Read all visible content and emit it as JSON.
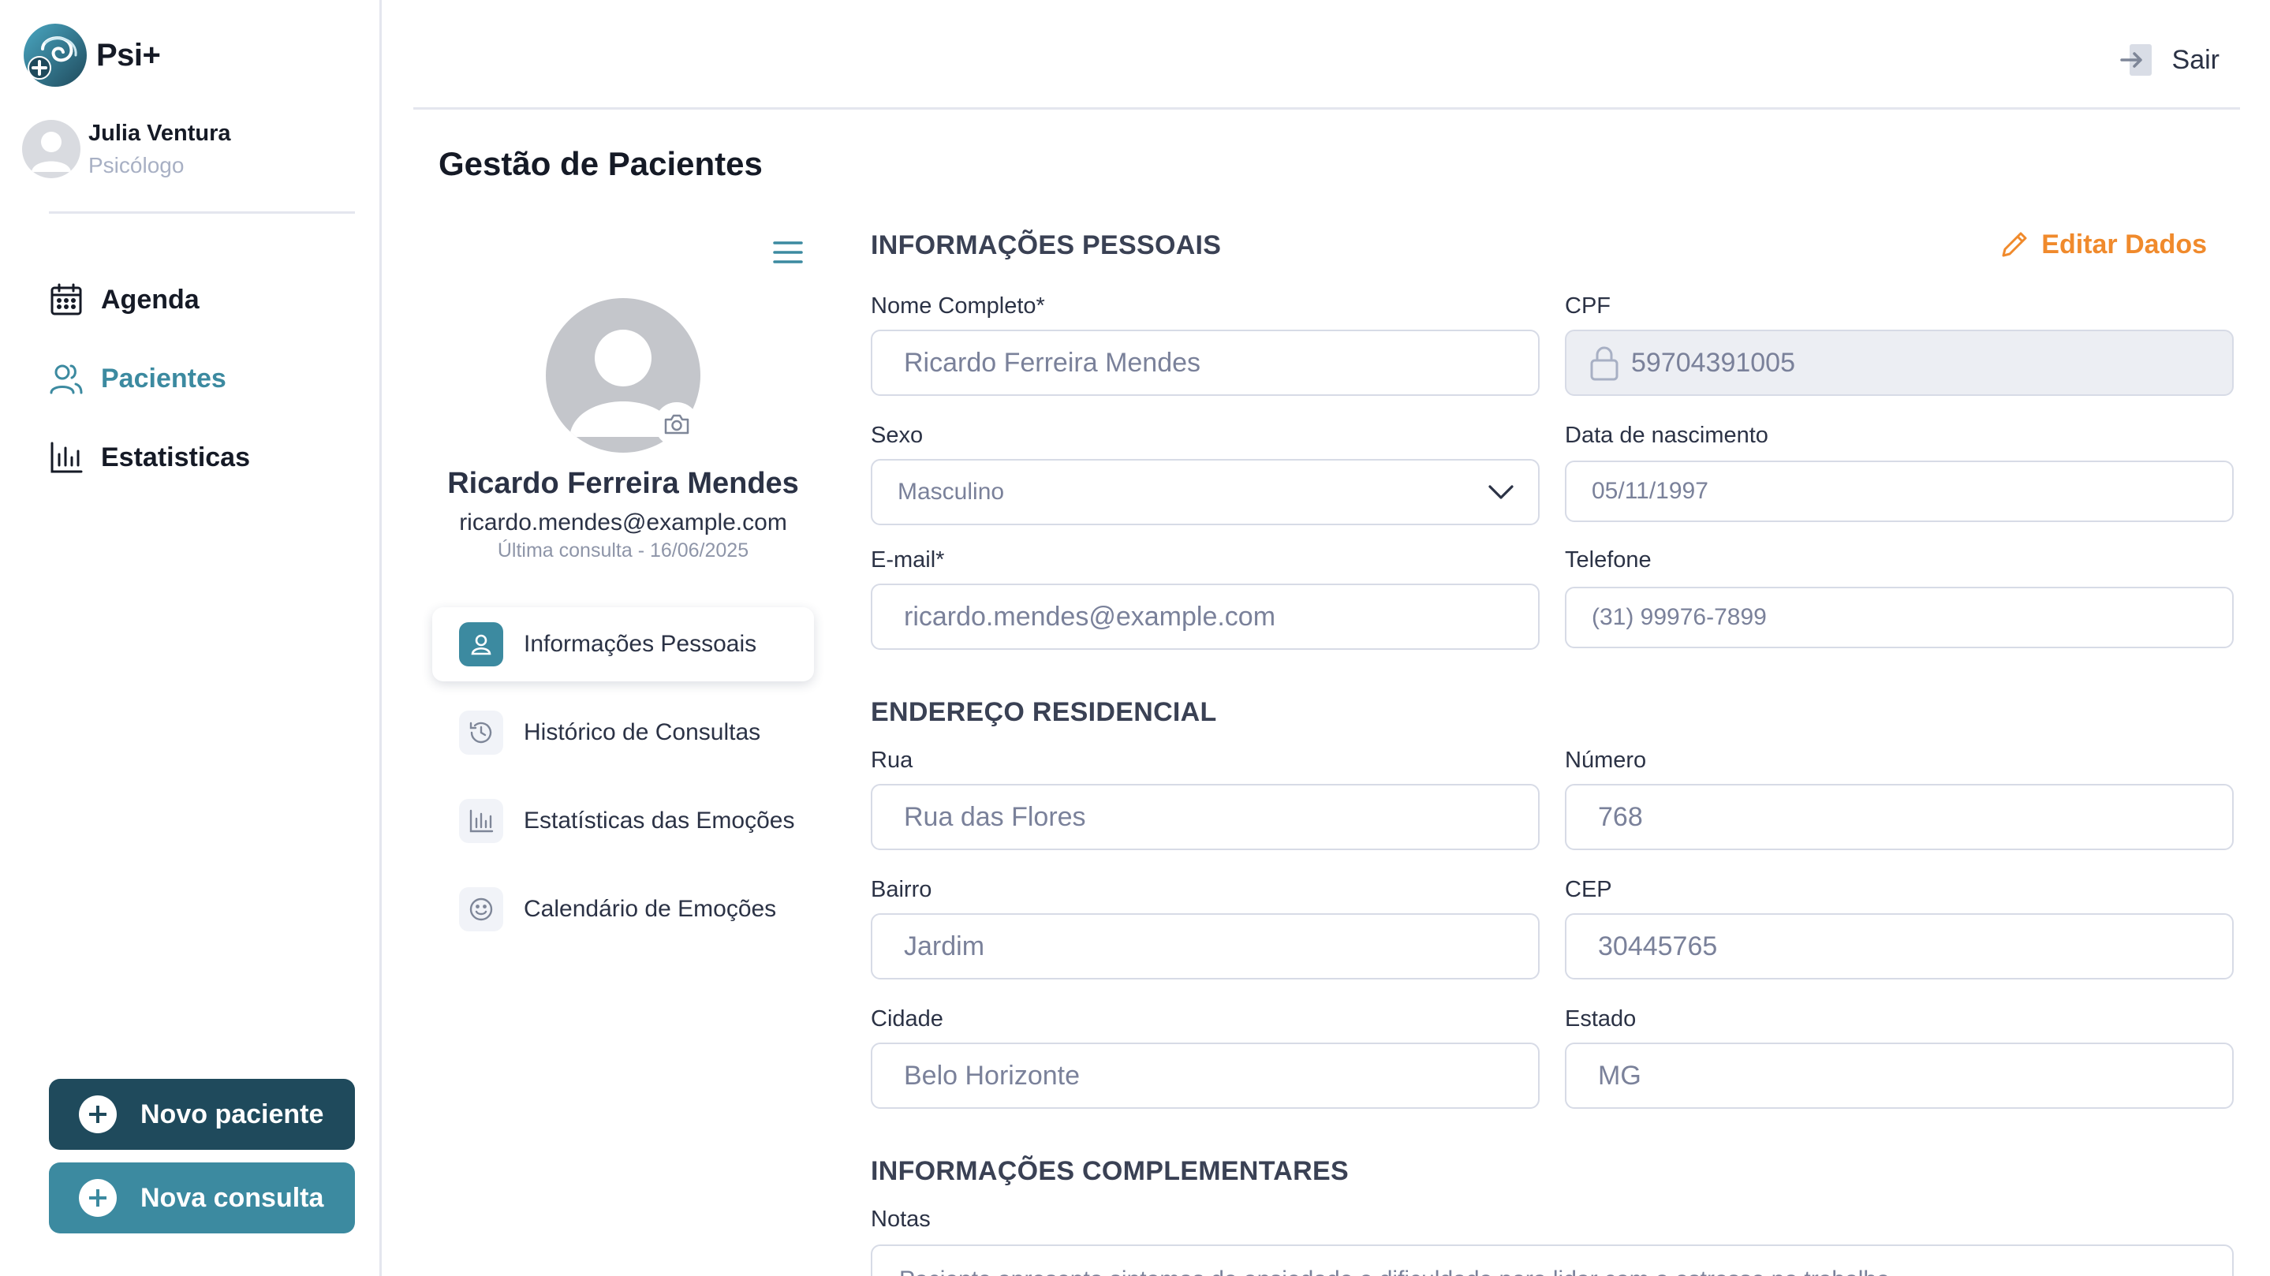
{
  "app": {
    "name": "Psi+"
  },
  "user": {
    "name": "Julia Ventura",
    "role": "Psicólogo"
  },
  "nav": [
    {
      "label": "Agenda",
      "icon": "calendar-icon",
      "active": false
    },
    {
      "label": "Pacientes",
      "icon": "users-icon",
      "active": true
    },
    {
      "label": "Estatisticas",
      "icon": "bar-chart-icon",
      "active": false
    }
  ],
  "actions": {
    "novo_paciente": "Novo paciente",
    "nova_consulta": "Nova consulta"
  },
  "header": {
    "sair": "Sair"
  },
  "page": {
    "title": "Gestão de Pacientes"
  },
  "patient": {
    "name": "Ricardo Ferreira Mendes",
    "email": "ricardo.mendes@example.com",
    "last_consult": "Última consulta - 16/06/2025"
  },
  "patient_menu": [
    {
      "label": "Informações Pessoais",
      "icon": "user-icon",
      "active": true
    },
    {
      "label": "Histórico de Consultas",
      "icon": "history-icon",
      "active": false
    },
    {
      "label": "Estatísticas das Emoções",
      "icon": "bar-chart-icon",
      "active": false
    },
    {
      "label": "Calendário de Emoções",
      "icon": "smile-icon",
      "active": false
    }
  ],
  "personal": {
    "section_title": "INFORMAÇÕES PESSOAIS",
    "edit_label": "Editar Dados",
    "nome_label": "Nome Completo*",
    "nome_value": "Ricardo Ferreira Mendes",
    "cpf_label": "CPF",
    "cpf_value": "59704391005",
    "sexo_label": "Sexo",
    "sexo_value": "Masculino",
    "nascimento_label": "Data de nascimento",
    "nascimento_value": "05/11/1997",
    "email_label": "E-mail*",
    "email_value": "ricardo.mendes@example.com",
    "telefone_label": "Telefone",
    "telefone_value": "(31) 99976-7899"
  },
  "address": {
    "section_title": "ENDEREÇO RESIDENCIAL",
    "rua_label": "Rua",
    "rua_value": "Rua das Flores",
    "numero_label": "Número",
    "numero_value": "768",
    "bairro_label": "Bairro",
    "bairro_value": "Jardim",
    "cep_label": "CEP",
    "cep_value": "30445765",
    "cidade_label": "Cidade",
    "cidade_value": "Belo Horizonte",
    "estado_label": "Estado",
    "estado_value": "MG"
  },
  "complementary": {
    "section_title": "INFORMAÇÕES COMPLEMENTARES",
    "notas_label": "Notas",
    "notas_value": "Paciente apresenta sintomas de ansiedade e dificuldade para lidar com o estresse no trabalho."
  },
  "colors": {
    "primary": "#3c8aa0",
    "primary_dark": "#1f4a5c",
    "accent_orange": "#f08a2c",
    "muted_text": "#a8b0c4"
  }
}
